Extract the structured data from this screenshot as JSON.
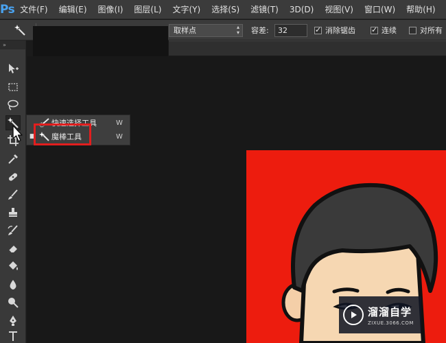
{
  "app": {
    "logo": "Ps",
    "menu": [
      "文件(F)",
      "编辑(E)",
      "图像(I)",
      "图层(L)",
      "文字(Y)",
      "选择(S)",
      "滤镜(T)",
      "3D(D)",
      "视图(V)",
      "窗口(W)",
      "帮助(H)"
    ]
  },
  "options_bar": {
    "tool_icon": "magic-wand-icon",
    "sample_size": "取样点",
    "tolerance_label": "容差:",
    "tolerance_value": "32",
    "anti_alias_label": "消除锯齿",
    "anti_alias_checked": true,
    "contiguous_label": "连续",
    "contiguous_checked": true,
    "sample_all_label": "对所有",
    "sample_all_checked": false
  },
  "toolbar": {
    "collapse_glyph": "»",
    "tools": [
      "move-icon",
      "marquee-icon",
      "lasso-icon",
      "magic-wand-icon",
      "crop-icon",
      "eyedropper-icon",
      "healing-brush-icon",
      "brush-icon",
      "clone-stamp-icon",
      "history-brush-icon",
      "eraser-icon",
      "paint-bucket-icon",
      "blur-icon",
      "dodge-icon",
      "pen-icon",
      "type-icon"
    ],
    "active_tool": "magic-wand-icon"
  },
  "flyout": {
    "items": [
      {
        "label": "快速选择工具",
        "shortcut": "W",
        "icon": "quick-selection-icon",
        "selected": false
      },
      {
        "label": "魔棒工具",
        "shortcut": "W",
        "icon": "magic-wand-icon",
        "selected": true
      }
    ],
    "bullet": "■"
  },
  "watermark": {
    "title": "溜溜自学",
    "subtitle": "ZIXUE.3066.COM"
  },
  "colors": {
    "canvas_red": "#ed1c0e",
    "highlight_red": "#e21e1e",
    "ps_blue": "#4aa3f0"
  }
}
